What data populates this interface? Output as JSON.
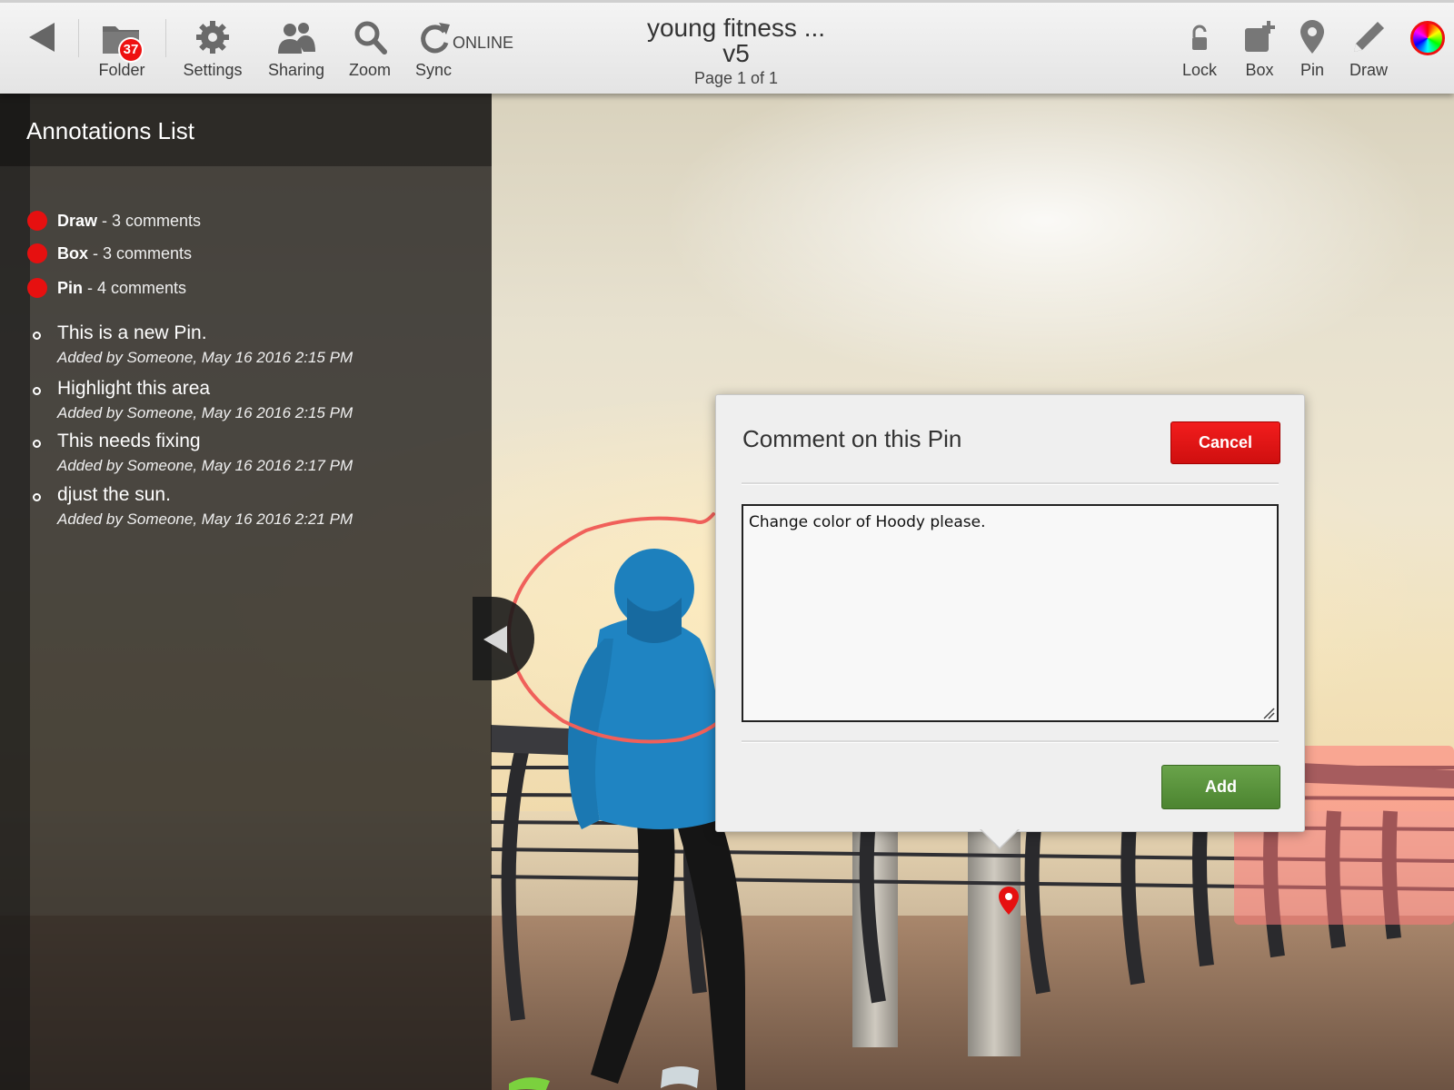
{
  "toolbar": {
    "back_icon": "back-arrow-icon",
    "folder": {
      "label": "Folder",
      "badge": "37",
      "icon": "folder-icon"
    },
    "settings": {
      "label": "Settings",
      "icon": "gear-icon"
    },
    "sharing": {
      "label": "Sharing",
      "icon": "users-icon"
    },
    "zoom": {
      "label": "Zoom",
      "icon": "magnifier-icon"
    },
    "sync": {
      "label": "Sync",
      "status": "ONLINE",
      "icon": "sync-icon"
    },
    "lock": {
      "label": "Lock",
      "icon": "lock-icon"
    },
    "box": {
      "label": "Box",
      "icon": "add-box-icon"
    },
    "pin": {
      "label": "Pin",
      "icon": "pin-icon"
    },
    "draw": {
      "label": "Draw",
      "icon": "pencil-icon"
    },
    "color_picker_icon": "color-wheel-icon"
  },
  "document": {
    "title": "young fitness ...",
    "version": "v5",
    "page_info": "Page 1 of 1"
  },
  "sidebar": {
    "title": "Annotations List",
    "categories": [
      {
        "name": "Draw",
        "count_text": " - 3 comments",
        "color": "#e61010"
      },
      {
        "name": "Box",
        "count_text": " - 3 comments",
        "color": "#e61010"
      },
      {
        "name": "Pin",
        "count_text": " - 4 comments",
        "color": "#e61010"
      }
    ],
    "comments": [
      {
        "text": "This is a new Pin.",
        "meta": "Added by Someone, May 16 2016 2:15 PM"
      },
      {
        "text": "Highlight this area",
        "meta": "Added by Someone, May 16 2016 2:15 PM"
      },
      {
        "text": "This needs fixing",
        "meta": "Added by Someone, May 16 2016 2:17 PM"
      },
      {
        "text": "djust the sun.",
        "meta": "Added by Someone, May 16 2016 2:21 PM"
      }
    ]
  },
  "popup": {
    "title": "Comment on this Pin",
    "cancel_label": "Cancel",
    "add_label": "Add",
    "comment_value": "Change color of Hoody please."
  },
  "colors": {
    "accent_red": "#e61010",
    "add_green": "#4c8430",
    "draw_stroke": "#f0605a"
  }
}
